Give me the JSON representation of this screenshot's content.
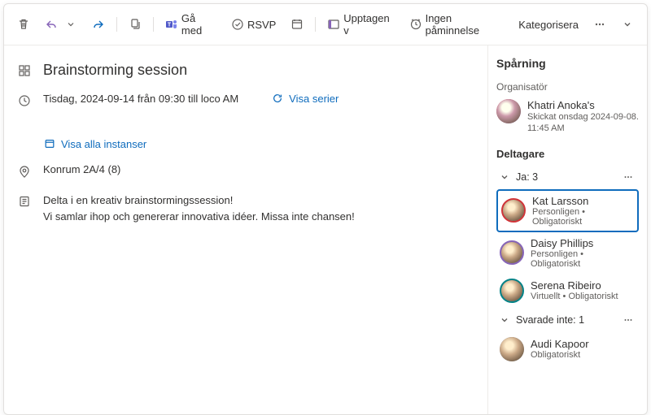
{
  "toolbar": {
    "join_label": "Gå med",
    "rsvp_label": "RSVP",
    "busy_label": "Upptagen v",
    "reminder_label": "Ingen påminnelse",
    "categorize_label": "Kategorisera"
  },
  "event": {
    "title": "Brainstorming session",
    "time_text": "Tisdag, 2024-09-14 från 09:30 till loco AM",
    "show_series": "Visa serier",
    "show_instances": "Visa alla instanser",
    "location": "Konrum 2A/4 (8)",
    "body_line1": "Delta i en kreativ brainstormingssession!",
    "body_line2": "Vi samlar ihop och genererar innovativa idéer. Missa inte chansen!"
  },
  "tracking": {
    "heading": "Spårning",
    "organizer_label": "Organisatör",
    "organizer": {
      "name": "Khatri Anoka's",
      "sent_line": "Skickat onsdag 2024-09-08.",
      "sent_time": "11:45 AM"
    },
    "participants_label": "Deltagare",
    "groups": [
      {
        "label": "Ja: 3",
        "attendees": [
          {
            "name": "Kat Larsson",
            "sub": "Personligen • Obligatoriskt",
            "selected": true,
            "ring": "avatar-ring"
          },
          {
            "name": "Daisy Phillips",
            "sub": "Personligen • Obligatoriskt",
            "selected": false,
            "ring": "avatar-ring2"
          },
          {
            "name": "Serena Ribeiro",
            "sub": "Virtuellt • Obligatoriskt",
            "selected": false,
            "ring": "avatar-ring3"
          }
        ]
      },
      {
        "label": "Svarade inte: 1",
        "attendees": [
          {
            "name": "Audi Kapoor",
            "sub": "Obligatoriskt",
            "selected": false,
            "ring": ""
          }
        ]
      }
    ]
  }
}
